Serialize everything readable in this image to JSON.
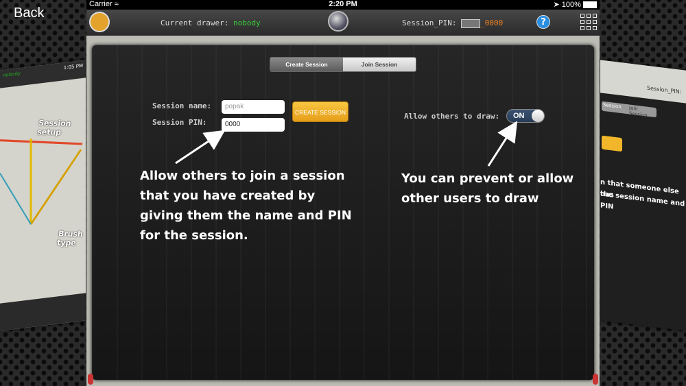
{
  "nav": {
    "back_label": "Back"
  },
  "status_bar": {
    "carrier": "Carrier",
    "time": "2:20 PM",
    "battery": "100%"
  },
  "toolbar": {
    "drawer_label": "Current drawer:",
    "drawer_value": "nobody",
    "session_pin_label": "Session_PIN:",
    "session_pin_value": "_0000"
  },
  "tabs": [
    {
      "label": "Create Session",
      "selected": true
    },
    {
      "label": "Join Session",
      "selected": false
    }
  ],
  "form": {
    "session_name_label": "Session name:",
    "session_name_value": "popak",
    "session_pin_label": "Session PIN:",
    "session_pin_value": "0000",
    "create_button_label": "CREATE SESSION",
    "allow_draw_label": "Allow others to draw:",
    "allow_draw_toggle": "ON"
  },
  "annotations": {
    "left": [
      "Allow others to join a session",
      "that you have created by",
      "giving them the name and PIN",
      "for the session."
    ],
    "right": [
      "You can prevent or allow",
      "other users to draw"
    ]
  },
  "side_left": {
    "drawer_value": "nobody",
    "time": "1:05 PM",
    "session_setup": "Session setup",
    "brush_type": "Brush type"
  },
  "side_right": {
    "session_pin_label": "Session_PIN:",
    "tab_left": "Session",
    "tab_right": "Join Session",
    "lines": [
      "n that someone else has",
      "the session name and PIN"
    ]
  },
  "colors": {
    "drawer_value": "#35d135",
    "pin_value": "#f08020",
    "button": "#f2b62a",
    "toggle": "#2d4666"
  },
  "icons": [
    "folder-icon",
    "globe-icon",
    "help-icon",
    "grid-menu-icon",
    "wifi-icon",
    "location-icon",
    "battery-icon"
  ]
}
